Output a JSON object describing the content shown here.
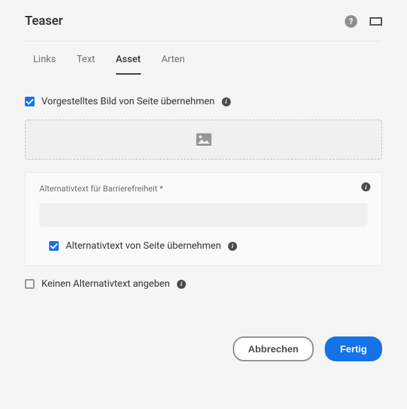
{
  "header": {
    "title": "Teaser"
  },
  "tabs": {
    "items": [
      {
        "label": "Links"
      },
      {
        "label": "Text"
      },
      {
        "label": "Asset"
      },
      {
        "label": "Arten"
      }
    ],
    "activeIndex": 2
  },
  "asset": {
    "inheritImageLabel": "Vorgestelltes Bild von Seite übernehmen",
    "inheritImageChecked": true,
    "altTextLabel": "Alternativtext für Barrierefreiheit *",
    "altTextValue": "",
    "inheritAltLabel": "Alternativtext von Seite übernehmen",
    "inheritAltChecked": true,
    "noAltLabel": "Keinen Alternativtext angeben",
    "noAltChecked": false
  },
  "footer": {
    "cancel": "Abbrechen",
    "done": "Fertig"
  }
}
